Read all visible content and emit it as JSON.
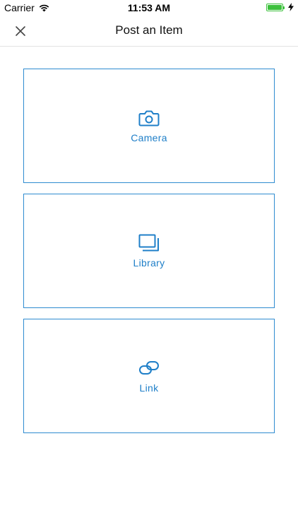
{
  "status_bar": {
    "carrier": "Carrier",
    "time": "11:53 AM",
    "battery_level": 1.0
  },
  "nav": {
    "title": "Post an Item",
    "close_icon": "close-icon"
  },
  "options": [
    {
      "label": "Camera",
      "icon": "camera-icon"
    },
    {
      "label": "Library",
      "icon": "library-icon"
    },
    {
      "label": "Link",
      "icon": "link-icon"
    }
  ],
  "colors": {
    "accent": "#1f7fc8",
    "border": "#2e8bd0",
    "battery": "#3cc13c",
    "divider": "#e2e2e2"
  }
}
